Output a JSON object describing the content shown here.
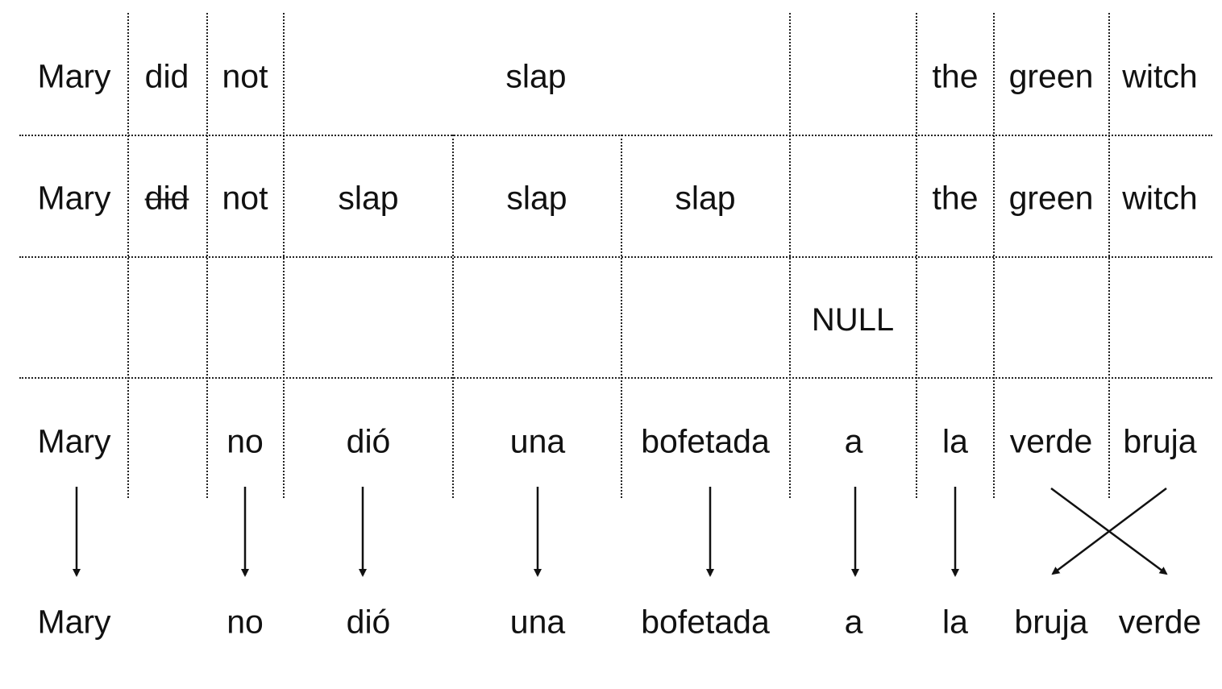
{
  "rows": {
    "english": [
      "Mary",
      "did",
      "not",
      "slap",
      "the",
      "green",
      "witch"
    ],
    "fertility": [
      "Mary",
      "did",
      "not",
      "slap",
      "slap",
      "slap",
      "the",
      "green",
      "witch"
    ],
    "null_label": "NULL",
    "translated": [
      "Mary",
      "no",
      "dió",
      "una",
      "bofetada",
      "a",
      "la",
      "verde",
      "bruja"
    ],
    "reordered": [
      "Mary",
      "no",
      "dió",
      "una",
      "bofetada",
      "a",
      "la",
      "bruja",
      "verde"
    ]
  },
  "alignment": {
    "straight": [
      "Mary",
      "no",
      "dió",
      "una",
      "bofetada",
      "a",
      "la"
    ],
    "crossed": [
      {
        "from": "verde",
        "to": "verde"
      },
      {
        "from": "bruja",
        "to": "bruja"
      }
    ],
    "deleted_word": "did"
  },
  "colors": {
    "text": "#111111",
    "grid": "#222222",
    "arrow": "#111111"
  }
}
